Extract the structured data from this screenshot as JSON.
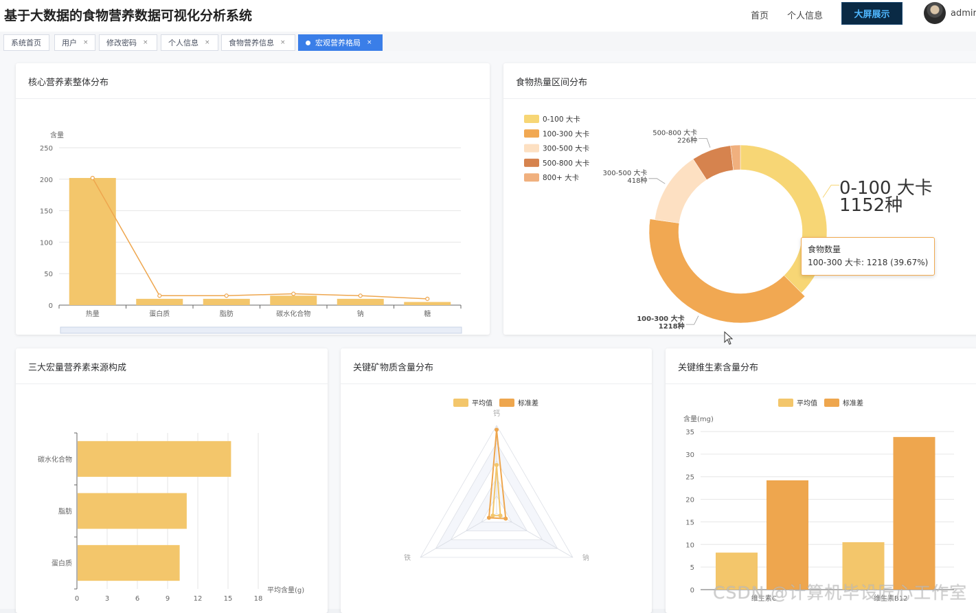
{
  "header": {
    "title": "基于大数据的食物营养数据可视化分析系统",
    "nav": [
      "首页",
      "个人信息"
    ],
    "screen_button": "大屏展示",
    "username": "admir"
  },
  "tabs": [
    {
      "label": "系统首页",
      "closable": false,
      "active": false
    },
    {
      "label": "用户",
      "closable": true,
      "active": false
    },
    {
      "label": "修改密码",
      "closable": true,
      "active": false
    },
    {
      "label": "个人信息",
      "closable": true,
      "active": false
    },
    {
      "label": "食物营养信息",
      "closable": true,
      "active": false
    },
    {
      "label": "宏观营养格局",
      "closable": true,
      "active": true
    }
  ],
  "close_glyph": "×",
  "colors": {
    "bar_yellow": "#f3c66b",
    "line_orange": "#eea64e",
    "donut": [
      "#f7d675",
      "#f1a852",
      "#fde0c2",
      "#d6834e",
      "#f0b07e"
    ],
    "accent_blue": "#3a7ee8"
  },
  "cards": {
    "nutrients": {
      "title": "核心营养素整体分布"
    },
    "calorie": {
      "title": "食物热量区间分布"
    },
    "macro": {
      "title": "三大宏量营养素来源构成"
    },
    "minerals": {
      "title": "关键矿物质含量分布"
    },
    "vitamins": {
      "title": "关键维生素含量分布"
    }
  },
  "chart_data": [
    {
      "type": "bar",
      "title": "核心营养素整体分布",
      "ylabel": "含量",
      "categories": [
        "热量",
        "蛋白质",
        "脂肪",
        "碳水化合物",
        "钠",
        "糖"
      ],
      "series": [
        {
          "type": "bar",
          "values": [
            202,
            10,
            10,
            15,
            10,
            5
          ]
        },
        {
          "type": "line",
          "values": [
            202,
            15,
            15,
            18,
            15,
            10
          ]
        }
      ],
      "ylim": [
        0,
        250
      ],
      "yticks": [
        0,
        50,
        100,
        150,
        200,
        250
      ],
      "grid": true
    },
    {
      "type": "pie",
      "title": "食物热量区间分布",
      "legend_position": "top-left",
      "slices": [
        {
          "label": "0-100 大卡",
          "value": 1152,
          "count_label": "1152种"
        },
        {
          "label": "100-300 大卡",
          "value": 1218,
          "count_label": "1218种"
        },
        {
          "label": "300-500 大卡",
          "value": 418,
          "count_label": "418种"
        },
        {
          "label": "500-800 大卡",
          "value": 226,
          "count_label": "226种"
        },
        {
          "label": "800+ 大卡",
          "value": 56,
          "count_label": ""
        }
      ],
      "emphasis_label": [
        "0-100 大卡",
        "1152种"
      ],
      "tooltip": {
        "title": "食物数量",
        "text": "100-300 大卡: 1218 (39.67%)"
      }
    },
    {
      "type": "bar",
      "orientation": "horizontal",
      "title": "三大宏量营养素来源构成",
      "xlabel": "平均含量(g)",
      "categories": [
        "碳水化合物",
        "脂肪",
        "蛋白质"
      ],
      "values": [
        15.3,
        10.9,
        10.2
      ],
      "xlim": [
        0,
        18
      ],
      "xticks": [
        0,
        3,
        6,
        9,
        12,
        15,
        18
      ]
    },
    {
      "type": "radar",
      "title": "关键矿物质含量分布",
      "indicators": [
        "钙",
        "钠",
        "铁"
      ],
      "legend": [
        "平均值",
        "标准差"
      ],
      "series": [
        {
          "name": "平均值",
          "values": [
            0.55,
            0.05,
            0.05
          ]
        },
        {
          "name": "标准差",
          "values": [
            0.95,
            0.12,
            0.1
          ]
        }
      ]
    },
    {
      "type": "bar",
      "title": "关键维生素含量分布",
      "ylabel": "含量(mg)",
      "legend": [
        "平均值",
        "标准差"
      ],
      "categories": [
        "维生素C",
        "维生素B12"
      ],
      "series": [
        {
          "name": "平均值",
          "values": [
            8.2,
            10.5
          ]
        },
        {
          "name": "标准差",
          "values": [
            24.2,
            33.8
          ]
        }
      ],
      "ylim": [
        0,
        35
      ],
      "yticks": [
        0,
        5,
        10,
        15,
        20,
        25,
        30,
        35
      ]
    }
  ],
  "watermark": "CSDN @计算机毕设匠心工作室"
}
